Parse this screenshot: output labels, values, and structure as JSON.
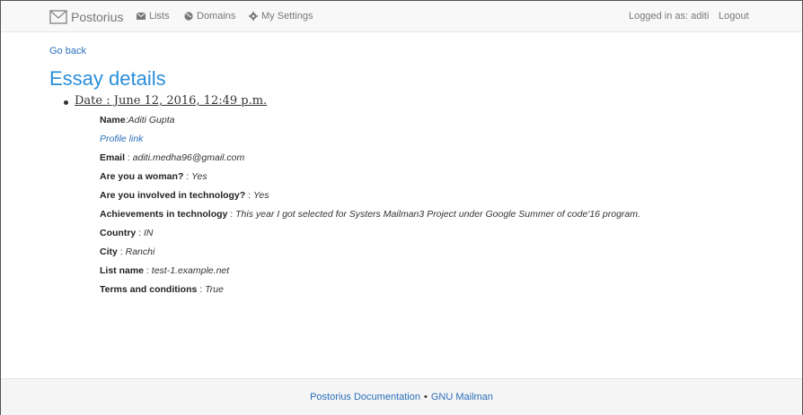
{
  "navbar": {
    "brand": "Postorius",
    "items": [
      {
        "label": "Lists",
        "icon": "envelope-icon"
      },
      {
        "label": "Domains",
        "icon": "globe-icon"
      },
      {
        "label": "My Settings",
        "icon": "gear-icon"
      }
    ],
    "logged_in": "Logged in as: aditi",
    "logout": "Logout"
  },
  "go_back": "Go back",
  "page_title": "Essay details",
  "essay": {
    "date": "Date : June 12, 2016, 12:49 p.m.",
    "name_label": "Name",
    "name_value": ":Aditi Gupta",
    "profile_link": "Profile link",
    "fields": [
      {
        "label": "Email",
        "sep": " : ",
        "value": "aditi.medha96@gmail.com"
      },
      {
        "label": "Are you a woman?",
        "sep": " : ",
        "value": "Yes"
      },
      {
        "label": "Are you involved in technology?",
        "sep": " : ",
        "value": "Yes"
      },
      {
        "label": "Achievements in technology",
        "sep": " : ",
        "value": "This year I got selected for Systers Mailman3 Project under Google Summer of code'16 program."
      },
      {
        "label": "Country",
        "sep": " : ",
        "value": "IN"
      },
      {
        "label": "City",
        "sep": " : ",
        "value": "Ranchi"
      },
      {
        "label": "List name",
        "sep": " : ",
        "value": "test-1.example.net"
      },
      {
        "label": "Terms and conditions",
        "sep": " : ",
        "value": "True"
      }
    ]
  },
  "footer": {
    "doc_link": "Postorius Documentation",
    "separator": "•",
    "mailman_link": "GNU Mailman"
  },
  "colors": {
    "link": "#2a6fbb",
    "title": "#2a8fd9",
    "navbar_bg": "#f8f8f8",
    "footer_bg": "#f5f5f5"
  }
}
